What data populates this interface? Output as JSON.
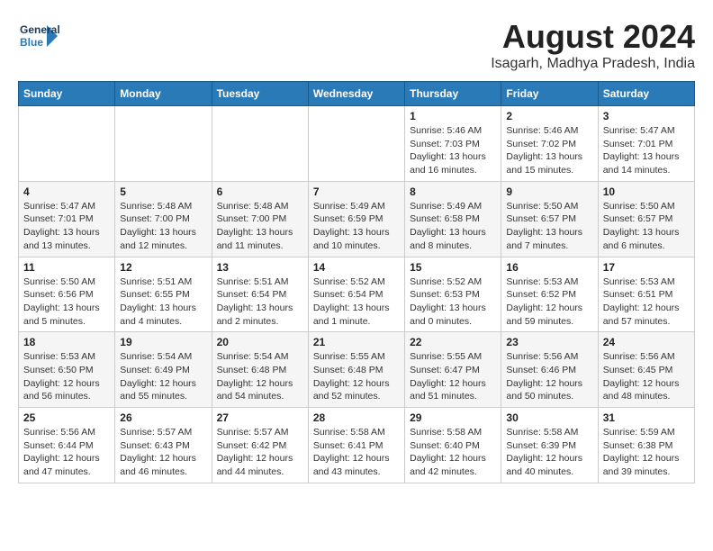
{
  "header": {
    "logo_line1": "General",
    "logo_line2": "Blue",
    "month_title": "August 2024",
    "location": "Isagarh, Madhya Pradesh, India"
  },
  "weekdays": [
    "Sunday",
    "Monday",
    "Tuesday",
    "Wednesday",
    "Thursday",
    "Friday",
    "Saturday"
  ],
  "weeks": [
    [
      {
        "day": "",
        "info": ""
      },
      {
        "day": "",
        "info": ""
      },
      {
        "day": "",
        "info": ""
      },
      {
        "day": "",
        "info": ""
      },
      {
        "day": "1",
        "info": "Sunrise: 5:46 AM\nSunset: 7:03 PM\nDaylight: 13 hours\nand 16 minutes."
      },
      {
        "day": "2",
        "info": "Sunrise: 5:46 AM\nSunset: 7:02 PM\nDaylight: 13 hours\nand 15 minutes."
      },
      {
        "day": "3",
        "info": "Sunrise: 5:47 AM\nSunset: 7:01 PM\nDaylight: 13 hours\nand 14 minutes."
      }
    ],
    [
      {
        "day": "4",
        "info": "Sunrise: 5:47 AM\nSunset: 7:01 PM\nDaylight: 13 hours\nand 13 minutes."
      },
      {
        "day": "5",
        "info": "Sunrise: 5:48 AM\nSunset: 7:00 PM\nDaylight: 13 hours\nand 12 minutes."
      },
      {
        "day": "6",
        "info": "Sunrise: 5:48 AM\nSunset: 7:00 PM\nDaylight: 13 hours\nand 11 minutes."
      },
      {
        "day": "7",
        "info": "Sunrise: 5:49 AM\nSunset: 6:59 PM\nDaylight: 13 hours\nand 10 minutes."
      },
      {
        "day": "8",
        "info": "Sunrise: 5:49 AM\nSunset: 6:58 PM\nDaylight: 13 hours\nand 8 minutes."
      },
      {
        "day": "9",
        "info": "Sunrise: 5:50 AM\nSunset: 6:57 PM\nDaylight: 13 hours\nand 7 minutes."
      },
      {
        "day": "10",
        "info": "Sunrise: 5:50 AM\nSunset: 6:57 PM\nDaylight: 13 hours\nand 6 minutes."
      }
    ],
    [
      {
        "day": "11",
        "info": "Sunrise: 5:50 AM\nSunset: 6:56 PM\nDaylight: 13 hours\nand 5 minutes."
      },
      {
        "day": "12",
        "info": "Sunrise: 5:51 AM\nSunset: 6:55 PM\nDaylight: 13 hours\nand 4 minutes."
      },
      {
        "day": "13",
        "info": "Sunrise: 5:51 AM\nSunset: 6:54 PM\nDaylight: 13 hours\nand 2 minutes."
      },
      {
        "day": "14",
        "info": "Sunrise: 5:52 AM\nSunset: 6:54 PM\nDaylight: 13 hours\nand 1 minute."
      },
      {
        "day": "15",
        "info": "Sunrise: 5:52 AM\nSunset: 6:53 PM\nDaylight: 13 hours\nand 0 minutes."
      },
      {
        "day": "16",
        "info": "Sunrise: 5:53 AM\nSunset: 6:52 PM\nDaylight: 12 hours\nand 59 minutes."
      },
      {
        "day": "17",
        "info": "Sunrise: 5:53 AM\nSunset: 6:51 PM\nDaylight: 12 hours\nand 57 minutes."
      }
    ],
    [
      {
        "day": "18",
        "info": "Sunrise: 5:53 AM\nSunset: 6:50 PM\nDaylight: 12 hours\nand 56 minutes."
      },
      {
        "day": "19",
        "info": "Sunrise: 5:54 AM\nSunset: 6:49 PM\nDaylight: 12 hours\nand 55 minutes."
      },
      {
        "day": "20",
        "info": "Sunrise: 5:54 AM\nSunset: 6:48 PM\nDaylight: 12 hours\nand 54 minutes."
      },
      {
        "day": "21",
        "info": "Sunrise: 5:55 AM\nSunset: 6:48 PM\nDaylight: 12 hours\nand 52 minutes."
      },
      {
        "day": "22",
        "info": "Sunrise: 5:55 AM\nSunset: 6:47 PM\nDaylight: 12 hours\nand 51 minutes."
      },
      {
        "day": "23",
        "info": "Sunrise: 5:56 AM\nSunset: 6:46 PM\nDaylight: 12 hours\nand 50 minutes."
      },
      {
        "day": "24",
        "info": "Sunrise: 5:56 AM\nSunset: 6:45 PM\nDaylight: 12 hours\nand 48 minutes."
      }
    ],
    [
      {
        "day": "25",
        "info": "Sunrise: 5:56 AM\nSunset: 6:44 PM\nDaylight: 12 hours\nand 47 minutes."
      },
      {
        "day": "26",
        "info": "Sunrise: 5:57 AM\nSunset: 6:43 PM\nDaylight: 12 hours\nand 46 minutes."
      },
      {
        "day": "27",
        "info": "Sunrise: 5:57 AM\nSunset: 6:42 PM\nDaylight: 12 hours\nand 44 minutes."
      },
      {
        "day": "28",
        "info": "Sunrise: 5:58 AM\nSunset: 6:41 PM\nDaylight: 12 hours\nand 43 minutes."
      },
      {
        "day": "29",
        "info": "Sunrise: 5:58 AM\nSunset: 6:40 PM\nDaylight: 12 hours\nand 42 minutes."
      },
      {
        "day": "30",
        "info": "Sunrise: 5:58 AM\nSunset: 6:39 PM\nDaylight: 12 hours\nand 40 minutes."
      },
      {
        "day": "31",
        "info": "Sunrise: 5:59 AM\nSunset: 6:38 PM\nDaylight: 12 hours\nand 39 minutes."
      }
    ]
  ]
}
